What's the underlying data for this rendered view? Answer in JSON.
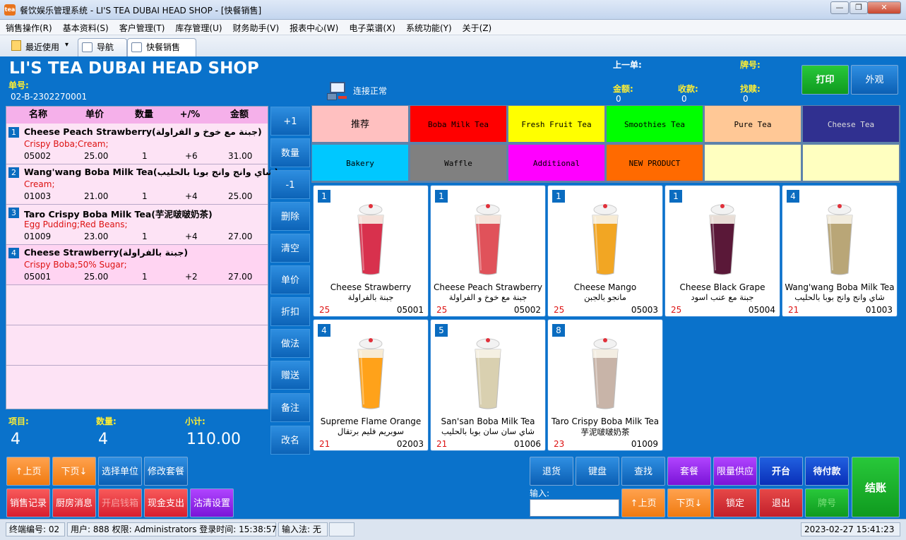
{
  "window": {
    "title": "餐饮娱乐管理系统 - LI'S TEA DUBAI HEAD SHOP - [快餐销售]",
    "app_icon": "tea-icon",
    "minimize": "—",
    "restore": "❐",
    "close": "✕"
  },
  "menu": [
    "销售操作(R)",
    "基本资料(S)",
    "客户管理(T)",
    "库存管理(U)",
    "财务助手(V)",
    "报表中心(W)",
    "电子菜谱(X)",
    "系统功能(Y)",
    "关于(Z)"
  ],
  "tabs": {
    "recent": "最近使用",
    "dropdown": "▾",
    "nav": "导航",
    "fast_sale": "快餐销售"
  },
  "header": {
    "shop_name": "LI'S TEA DUBAI HEAD SHOP",
    "order_no_label": "单号:",
    "order_no": "02-B-2302270001",
    "connection": "连接正常",
    "prev_order_label": "上一单:",
    "plate_label": "牌号:",
    "amount_label": "金额:",
    "amount": "0",
    "received_label": "收款:",
    "received": "0",
    "change_label": "找赎:",
    "change": "0",
    "print": "打印",
    "takeout": "外观"
  },
  "order_table": {
    "headers": [
      "名称",
      "单价",
      "数量",
      "+/%",
      "金额"
    ],
    "rows": [
      {
        "num": "1",
        "name": "Cheese Peach Strawberry(جبنة مع خوخ و الفراولة)",
        "options": "Crispy Boba;Cream;",
        "code": "05002",
        "price": "25.00",
        "qty": "1",
        "pct": "+6",
        "amount": "31.00"
      },
      {
        "num": "2",
        "name": "Wang'wang Boba Milk Tea(شاي وانج وانج بوبا بالحليب)",
        "options": "Cream;",
        "code": "01003",
        "price": "21.00",
        "qty": "1",
        "pct": "+4",
        "amount": "25.00"
      },
      {
        "num": "3",
        "name": "Taro Crispy Boba Milk Tea(芋泥啵啵奶茶)",
        "options": "Egg Pudding;Red Beans;",
        "code": "01009",
        "price": "23.00",
        "qty": "1",
        "pct": "+4",
        "amount": "27.00"
      },
      {
        "num": "4",
        "name": "Cheese Strawberry(جبنة بالفراولة)",
        "options": "Crispy Boba;50% Sugar;",
        "code": "05001",
        "price": "25.00",
        "qty": "1",
        "pct": "+2",
        "amount": "27.00"
      }
    ]
  },
  "summary": {
    "items_label": "项目:",
    "items": "4",
    "qty_label": "数量:",
    "qty": "4",
    "subtotal_label": "小计:",
    "subtotal": "110.00"
  },
  "side_buttons": [
    "+1",
    "数量",
    "-1",
    "删除",
    "清空",
    "单价",
    "折扣",
    "做法",
    "赠送",
    "备注",
    "改名"
  ],
  "categories": [
    {
      "label": "推荐",
      "color": "#ffc0c0"
    },
    {
      "label": "Boba Milk Tea",
      "color": "#ff0000"
    },
    {
      "label": "Fresh Fruit Tea",
      "color": "#ffff00"
    },
    {
      "label": "Smoothies Tea",
      "color": "#00ff00"
    },
    {
      "label": "Pure Tea",
      "color": "#ffc896"
    },
    {
      "label": "Cheese Tea",
      "color": "#303090"
    },
    {
      "label": "Bakery",
      "color": "#00c8ff"
    },
    {
      "label": "Waffle",
      "color": "#808080"
    },
    {
      "label": "Additional",
      "color": "#ff00ff"
    },
    {
      "label": "NEW PRODUCT",
      "color": "#ff6a00"
    },
    {
      "label": "",
      "color": "#ffffc0"
    },
    {
      "label": "",
      "color": "#ffffc0"
    }
  ],
  "products": [
    {
      "badge": "1",
      "name": "Cheese Strawberry",
      "name_ar": "جبنة بالفراولة",
      "stock": "25",
      "code": "05001",
      "drink": "#d8314d"
    },
    {
      "badge": "1",
      "name": "Cheese Peach Strawberry",
      "name_ar": "جبنة مع خوخ و الفراولة",
      "stock": "25",
      "code": "05002",
      "drink": "#e0525a"
    },
    {
      "badge": "1",
      "name": "Cheese Mango",
      "name_ar": "مانجو بالجبن",
      "stock": "25",
      "code": "05003",
      "drink": "#f2a623"
    },
    {
      "badge": "1",
      "name": "Cheese Black Grape",
      "name_ar": "جبنة مع عنب اسود",
      "stock": "25",
      "code": "05004",
      "drink": "#5a1838"
    },
    {
      "badge": "4",
      "name": "Wang'wang Boba Milk Tea",
      "name_ar": "شاي وانج وانج بوبا بالحليب",
      "stock": "21",
      "code": "01003",
      "drink": "#b9a677"
    },
    {
      "badge": "4",
      "name": "Supreme Flame Orange",
      "name_ar": "سوبريم فليم برتقال",
      "stock": "21",
      "code": "02003",
      "drink": "#ffa21a"
    },
    {
      "badge": "5",
      "name": "San'san Boba Milk Tea",
      "name_ar": "شاي سان سان بوبا بالحليب",
      "stock": "21",
      "code": "01006",
      "drink": "#d9d0b0"
    },
    {
      "badge": "8",
      "name": "Taro Crispy Boba Milk Tea",
      "name_ar": "芋泥啵啵奶茶",
      "stock": "23",
      "code": "01009",
      "drink": "#c8b4a8"
    }
  ],
  "bottom_left": {
    "page_up": "↑上页",
    "page_down": "下页↓",
    "select_unit": "选择单位",
    "modify_set": "修改套餐",
    "sales_record": "销售记录",
    "kitchen_msg": "厨房消息",
    "open_drawer": "开启钱箱",
    "cash_out": "现金支出",
    "clean_setting": "沽清设置"
  },
  "bottom_right": {
    "return": "退货",
    "keypad": "键盘",
    "search": "查找",
    "set_meal": "套餐",
    "limited": "限量供应",
    "open_table": "开台",
    "pending": "待付款",
    "input_label": "输入:",
    "input_value": "",
    "page_up": "↑上页",
    "page_down": "下页↓",
    "lock": "锁定",
    "exit": "退出",
    "plate": "牌号",
    "checkout": "结账"
  },
  "status": {
    "terminal": "终端编号: 02",
    "user": "用户: 888 权限: Administrators 登录时间: 15:38:57",
    "ime": "输入法: 无",
    "datetime": "2023-02-27 15:41:23"
  }
}
